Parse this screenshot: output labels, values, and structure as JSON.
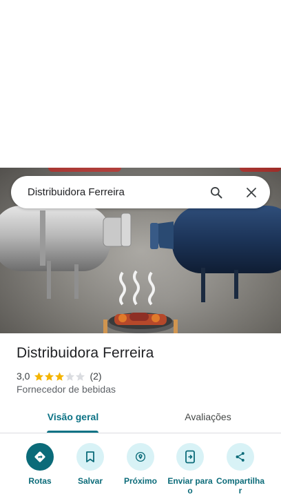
{
  "search": {
    "query": "Distribuidora Ferreira"
  },
  "place": {
    "name": "Distribuidora Ferreira",
    "rating": "3,0",
    "rating_value": 3,
    "reviews_count": "(2)",
    "category": "Fornecedor de bebidas"
  },
  "tabs": [
    {
      "label": "Visão geral",
      "active": true
    },
    {
      "label": "Avaliações",
      "active": false
    }
  ],
  "actions": [
    {
      "label": "Rotas",
      "icon": "directions-icon"
    },
    {
      "label": "Salvar",
      "icon": "bookmark-icon"
    },
    {
      "label": "Próximo",
      "icon": "nearby-icon"
    },
    {
      "label": "Enviar para o",
      "icon": "send-to-phone-icon"
    },
    {
      "label": "Compartilhar",
      "icon": "share-icon"
    }
  ],
  "colors": {
    "accent": "#0b6b79",
    "tab_active": "#0b7285",
    "action_bg": "#d8f2f6",
    "star": "#f4b400"
  }
}
